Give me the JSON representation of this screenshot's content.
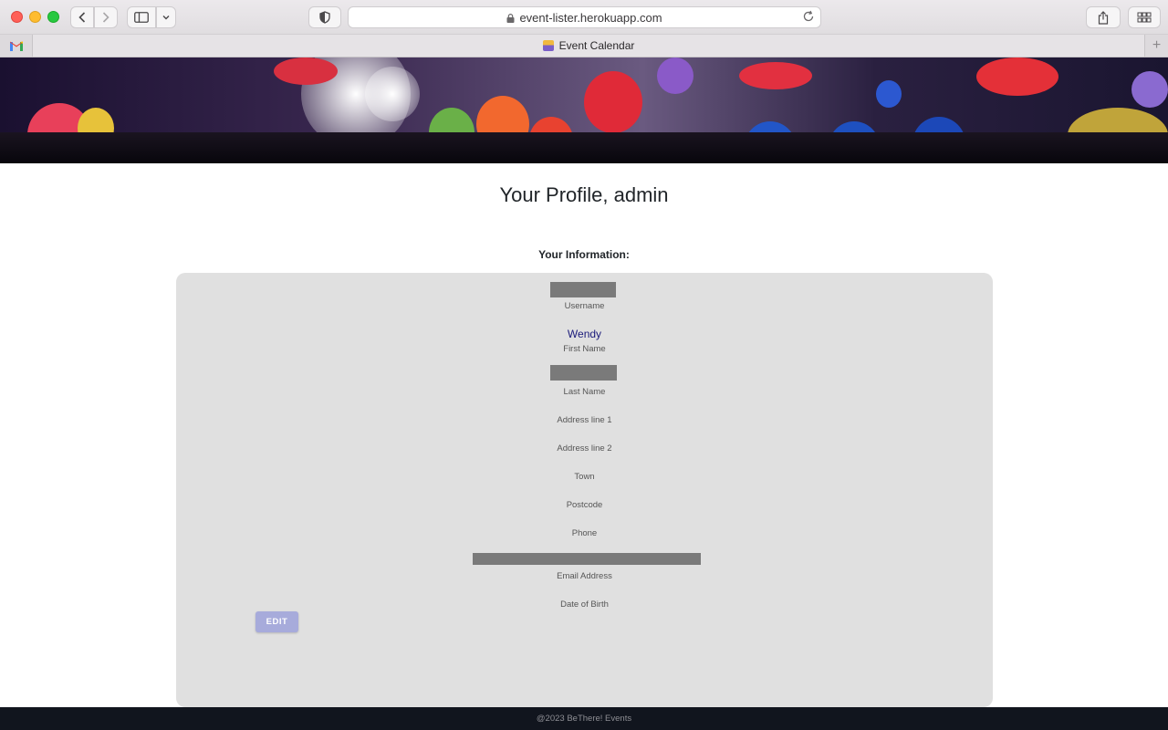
{
  "browser": {
    "url": "event-lister.herokuapp.com",
    "tab_title": "Event Calendar",
    "icons": {
      "back": "chevron-left-icon",
      "forward": "chevron-right-icon",
      "sidebar": "sidebar-icon",
      "privacy": "shield-icon",
      "lock": "lock-icon",
      "reload": "reload-icon",
      "share": "share-icon",
      "tabs": "tab-overview-icon",
      "new_tab": "plus-icon",
      "pinned": "gmail-icon"
    }
  },
  "page": {
    "title": "Your Profile, admin",
    "info_heading": "Your Information:",
    "fields": [
      {
        "label": "Username",
        "value": "",
        "redacted": true
      },
      {
        "label": "First Name",
        "value": "Wendy",
        "redacted": false
      },
      {
        "label": "Last Name",
        "value": "",
        "redacted": true
      },
      {
        "label": "Address line 1",
        "value": ""
      },
      {
        "label": "Address line 2",
        "value": ""
      },
      {
        "label": "Town",
        "value": ""
      },
      {
        "label": "Postcode",
        "value": ""
      },
      {
        "label": "Phone",
        "value": ""
      },
      {
        "label": "Email Address",
        "value": "",
        "redacted": true
      },
      {
        "label": "Date of Birth",
        "value": ""
      }
    ],
    "edit_label": "EDIT",
    "footer": "@2023 BeThere! Events"
  },
  "colors": {
    "card_bg": "#e0e0e0",
    "value_text": "#1a1a7a",
    "edit_button": "#a7abdb",
    "footer_bg": "#11151e",
    "redaction": "#7a7a7a"
  }
}
